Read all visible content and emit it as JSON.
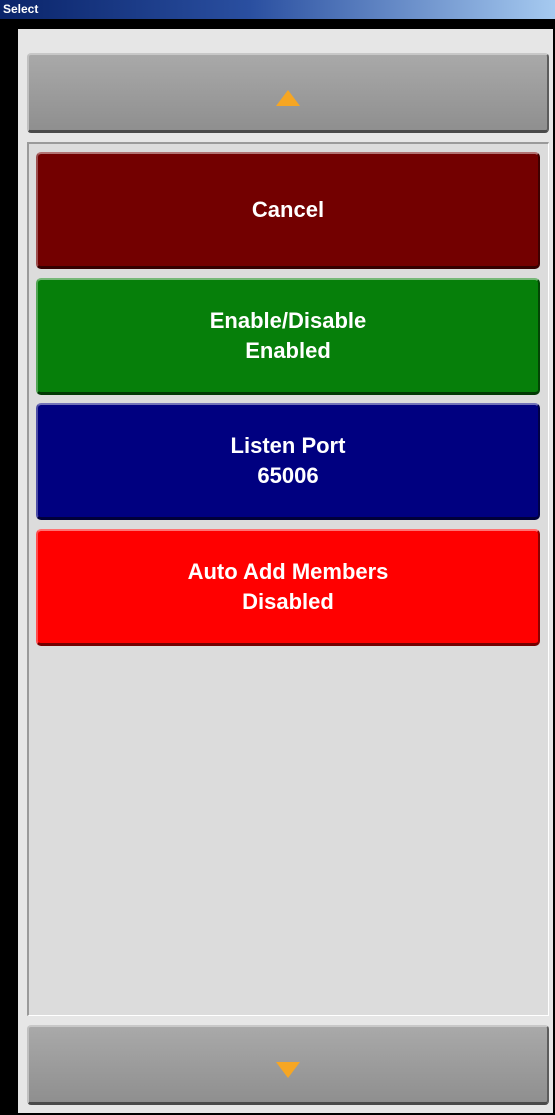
{
  "window": {
    "title": "Select"
  },
  "scroll": {
    "up_icon": "triangle-up-icon",
    "down_icon": "triangle-down-icon",
    "arrow_color": "#f6a623"
  },
  "options": [
    {
      "label": "Cancel",
      "value": "",
      "color": "#730000"
    },
    {
      "label": "Enable/Disable",
      "value": "Enabled",
      "color": "#067f0a"
    },
    {
      "label": "Listen Port",
      "value": "65006",
      "color": "#000080"
    },
    {
      "label": "Auto Add Members",
      "value": "Disabled",
      "color": "#ff0000"
    }
  ]
}
